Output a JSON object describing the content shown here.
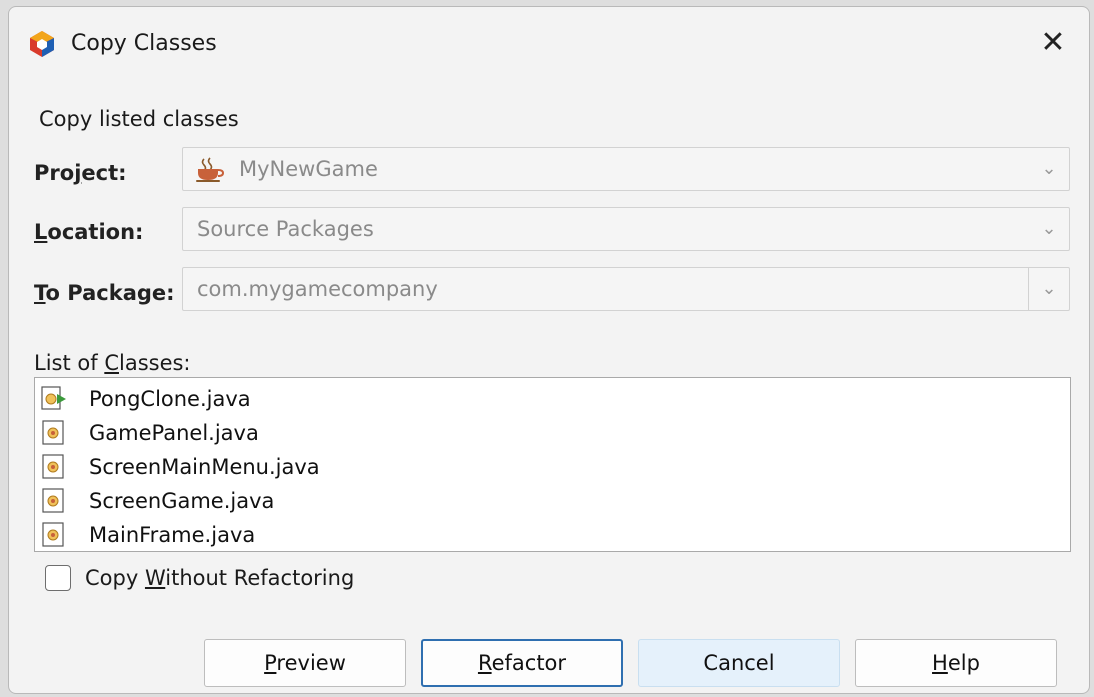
{
  "window": {
    "title": "Copy Classes",
    "close_glyph": "✕"
  },
  "section_label": "Copy listed classes",
  "fields": {
    "project": {
      "label": "Project:",
      "value": "MyNewGame",
      "icon": "java-coffee-cup-icon"
    },
    "location": {
      "label": "Location:",
      "value": "Source Packages"
    },
    "to_package": {
      "label": "To Package:",
      "value": "com.mygamecompany"
    }
  },
  "classes_label": "List of Classes:",
  "classes": [
    {
      "name": "PongClone.java",
      "icon": "java-main-class-icon"
    },
    {
      "name": "GamePanel.java",
      "icon": "java-class-icon"
    },
    {
      "name": "ScreenMainMenu.java",
      "icon": "java-class-icon"
    },
    {
      "name": "ScreenGame.java",
      "icon": "java-class-icon"
    },
    {
      "name": "MainFrame.java",
      "icon": "java-class-icon"
    }
  ],
  "checkbox": {
    "label": "Copy Without Refactoring",
    "checked": false
  },
  "buttons": {
    "preview": "Preview",
    "refactor": "Refactor",
    "cancel": "Cancel",
    "help": "Help"
  },
  "colors": {
    "default_button_border": "#2f6fb0",
    "focused_button_bg": "#e5f1fb"
  }
}
